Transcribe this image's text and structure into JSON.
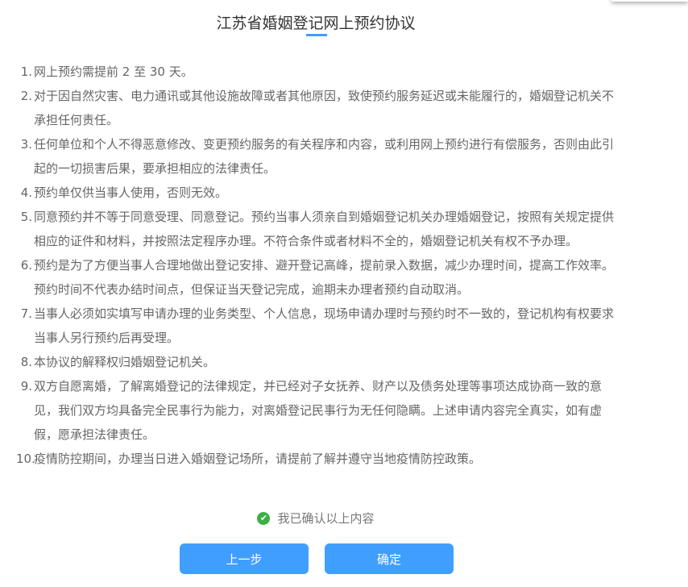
{
  "title": "江苏省婚姻登记网上预约协议",
  "items": [
    {
      "num": "1.",
      "text": "网上预约需提前 2 至 30 天。"
    },
    {
      "num": "2.",
      "text": "对于因自然灾害、电力通讯或其他设施故障或者其他原因，致使预约服务延迟或未能履行的，婚姻登记机关不承担任何责任。"
    },
    {
      "num": "3.",
      "text": "任何单位和个人不得恶意修改、变更预约服务的有关程序和内容，或利用网上预约进行有偿服务，否则由此引起的一切损害后果，要承担相应的法律责任。"
    },
    {
      "num": "4.",
      "text": "预约单仅供当事人使用，否则无效。"
    },
    {
      "num": "5.",
      "text": "同意预约并不等于同意受理、同意登记。预约当事人须亲自到婚姻登记机关办理婚姻登记，按照有关规定提供相应的证件和材料，并按照法定程序办理。不符合条件或者材料不全的，婚姻登记机关有权不予办理。"
    },
    {
      "num": "6.",
      "text": "预约是为了方便当事人合理地做出登记安排、避开登记高峰，提前录入数据，减少办理时间，提高工作效率。预约时间不代表办结时间点，但保证当天登记完成，逾期未办理者预约自动取消。"
    },
    {
      "num": "7.",
      "text": "当事人必须如实填写申请办理的业务类型、个人信息，现场申请办理时与预约时不一致的，登记机构有权要求当事人另行预约后再受理。"
    },
    {
      "num": "8.",
      "text": "本协议的解释权归婚姻登记机关。"
    },
    {
      "num": "9.",
      "text": "双方自愿离婚，了解离婚登记的法律规定，并已经对子女抚养、财产以及债务处理等事项达成协商一致的意见，我们双方均具备完全民事行为能力，对离婚登记民事行为无任何隐瞒。上述申请内容完全真实，如有虚假，愿承担法律责任。"
    },
    {
      "num": "10.",
      "text": "疫情防控期间，办理当日进入婚姻登记场所，请提前了解并遵守当地疫情防控政策。"
    }
  ],
  "confirm_label": "我已确认以上内容",
  "prev_label": "上一步",
  "ok_label": "确定",
  "colors": {
    "accent": "#409eff",
    "check": "#3cb043"
  }
}
